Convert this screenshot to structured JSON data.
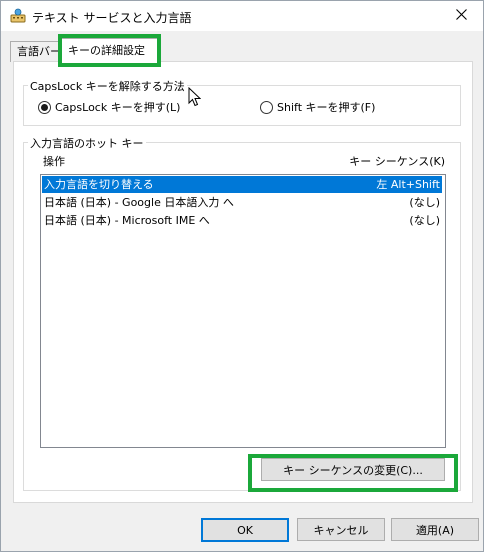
{
  "window": {
    "title": "テキスト サービスと入力言語",
    "icons": {
      "app": "keyboard-app-icon",
      "close": "close-icon"
    }
  },
  "tabs": [
    {
      "label": "言語バー",
      "active": false
    },
    {
      "label": "キーの詳細設定",
      "active": true
    }
  ],
  "capslock": {
    "group_label": "CapsLock キーを解除する方法",
    "options": [
      {
        "label": "CapsLock キーを押す(L)",
        "selected": true
      },
      {
        "label": "Shift キーを押す(F)",
        "selected": false
      }
    ]
  },
  "hotkeys": {
    "group_label": "入力言語のホット キー",
    "columns": {
      "action": "操作",
      "sequence": "キー シーケンス(K)"
    },
    "rows": [
      {
        "action": "入力言語を切り替える",
        "sequence": "左 Alt+Shift",
        "selected": true
      },
      {
        "action": "日本語 (日本) - Google 日本語入力 へ",
        "sequence": "(なし)",
        "selected": false
      },
      {
        "action": "日本語 (日本) - Microsoft IME へ",
        "sequence": "(なし)",
        "selected": false
      }
    ],
    "change_button": "キー シーケンスの変更(C)..."
  },
  "buttons": {
    "ok": "OK",
    "cancel": "キャンセル",
    "apply": "適用(A)"
  },
  "colors": {
    "highlight_box": "#1ba83a",
    "selection": "#0078d7"
  }
}
